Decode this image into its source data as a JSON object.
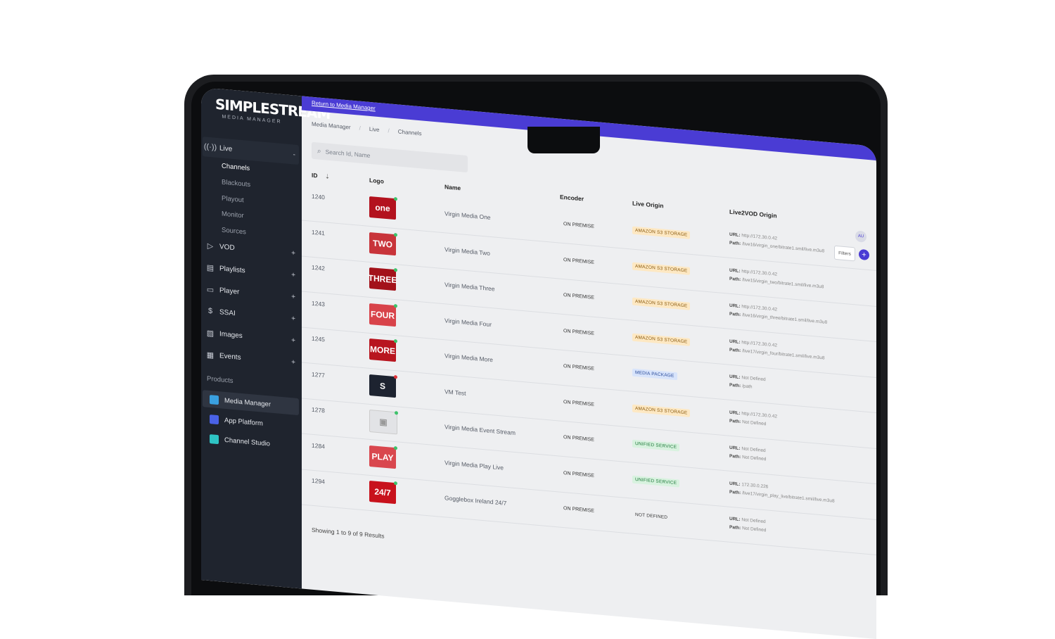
{
  "brand": {
    "name": "SIMPLESTREAM",
    "subtitle": "MEDIA MANAGER"
  },
  "sidebar": {
    "live_label": "Live",
    "live_items": [
      "Channels",
      "Blackouts",
      "Playout",
      "Monitor",
      "Sources"
    ],
    "items": [
      {
        "label": "VOD",
        "icon": "play-icon"
      },
      {
        "label": "Playlists",
        "icon": "film-icon"
      },
      {
        "label": "Player",
        "icon": "monitor-icon"
      },
      {
        "label": "SSAI",
        "icon": "dollar-icon"
      },
      {
        "label": "Images",
        "icon": "image-icon"
      },
      {
        "label": "Events",
        "icon": "calendar-icon"
      }
    ],
    "products_label": "Products",
    "products": [
      {
        "label": "Media Manager",
        "color": "#3aa0e0"
      },
      {
        "label": "App Platform",
        "color": "#4a62e6"
      },
      {
        "label": "Channel Studio",
        "color": "#2ec4c4"
      }
    ]
  },
  "topbar": {
    "return_link": "Return to Media Manager"
  },
  "breadcrumbs": [
    "Media Manager",
    "Live",
    "Channels"
  ],
  "search": {
    "placeholder": "Search Id, Name"
  },
  "header": {
    "avatar": "AU",
    "filters": "Filters",
    "add": "+"
  },
  "table": {
    "columns": [
      "ID",
      "Logo",
      "Name",
      "Encoder",
      "Live Origin",
      "Live2VOD Origin"
    ],
    "rows": [
      {
        "id": "1240",
        "logo": "one",
        "logo_bg": "#b3121e",
        "name": "Virgin Media One",
        "encoder": "ON PREMISE",
        "origin": "AMAZON S3 STORAGE",
        "origin_type": "amazon",
        "url": "http://172.30.0.42",
        "path": "/live16/virgin_one/bitrate1.smil/live.m3u8"
      },
      {
        "id": "1241",
        "logo": "TWO",
        "logo_bg": "#c8343a",
        "name": "Virgin Media Two",
        "encoder": "ON PREMISE",
        "origin": "AMAZON S3 STORAGE",
        "origin_type": "amazon",
        "url": "http://172.30.0.42",
        "path": "/live15/virgin_two/bitrate1.smil/live.m3u8"
      },
      {
        "id": "1242",
        "logo": "THREE",
        "logo_bg": "#a3121a",
        "name": "Virgin Media Three",
        "encoder": "ON PREMISE",
        "origin": "AMAZON S3 STORAGE",
        "origin_type": "amazon",
        "url": "http://172.30.0.42",
        "path": "/live16/virgin_three/bitrate1.smil/live.m3u8"
      },
      {
        "id": "1243",
        "logo": "FOUR",
        "logo_bg": "#d8434a",
        "name": "Virgin Media Four",
        "encoder": "ON PREMISE",
        "origin": "AMAZON S3 STORAGE",
        "origin_type": "amazon",
        "url": "http://172.30.0.42",
        "path": "/live17/virgin_four/bitrate1.smil/live.m3u8"
      },
      {
        "id": "1245",
        "logo": "MORE",
        "logo_bg": "#b8151f",
        "name": "Virgin Media More",
        "encoder": "ON PREMISE",
        "origin": "MEDIA PACKAGE",
        "origin_type": "media",
        "url": "Not Defined",
        "path": "/path"
      },
      {
        "id": "1277",
        "logo": "S",
        "logo_bg": "#1d2330",
        "name": "VM Test",
        "encoder": "ON PREMISE",
        "origin": "AMAZON S3 STORAGE",
        "origin_type": "amazon",
        "url": "http://172.30.0.42",
        "path": "Not Defined"
      },
      {
        "id": "1278",
        "logo": "",
        "logo_bg": "#e2e3e6",
        "name": "Virgin Media Event Stream",
        "encoder": "ON PREMISE",
        "origin": "UNIFIED SERVICE",
        "origin_type": "unified",
        "url": "Not Defined",
        "path": "Not Defined"
      },
      {
        "id": "1284",
        "logo": "PLAY",
        "logo_bg": "#d9474e",
        "name": "Virgin Media Play Live",
        "encoder": "ON PREMISE",
        "origin": "UNIFIED SERVICE",
        "origin_type": "unified",
        "url": "172.30.0.226",
        "path": "/live17/virgin_play_live/bitrate1.smil/live.m3u8"
      },
      {
        "id": "1294",
        "logo": "24/7",
        "logo_bg": "#c8121c",
        "name": "Gogglebox Ireland 24/7",
        "encoder": "ON PREMISE",
        "origin": "NOT DEFINED",
        "origin_type": "none",
        "url": "Not Defined",
        "path": "Not Defined"
      }
    ]
  },
  "labels": {
    "url": "URL:",
    "path": "Path:"
  },
  "footer": {
    "summary": "Showing 1 to 9 of 9 Results"
  }
}
